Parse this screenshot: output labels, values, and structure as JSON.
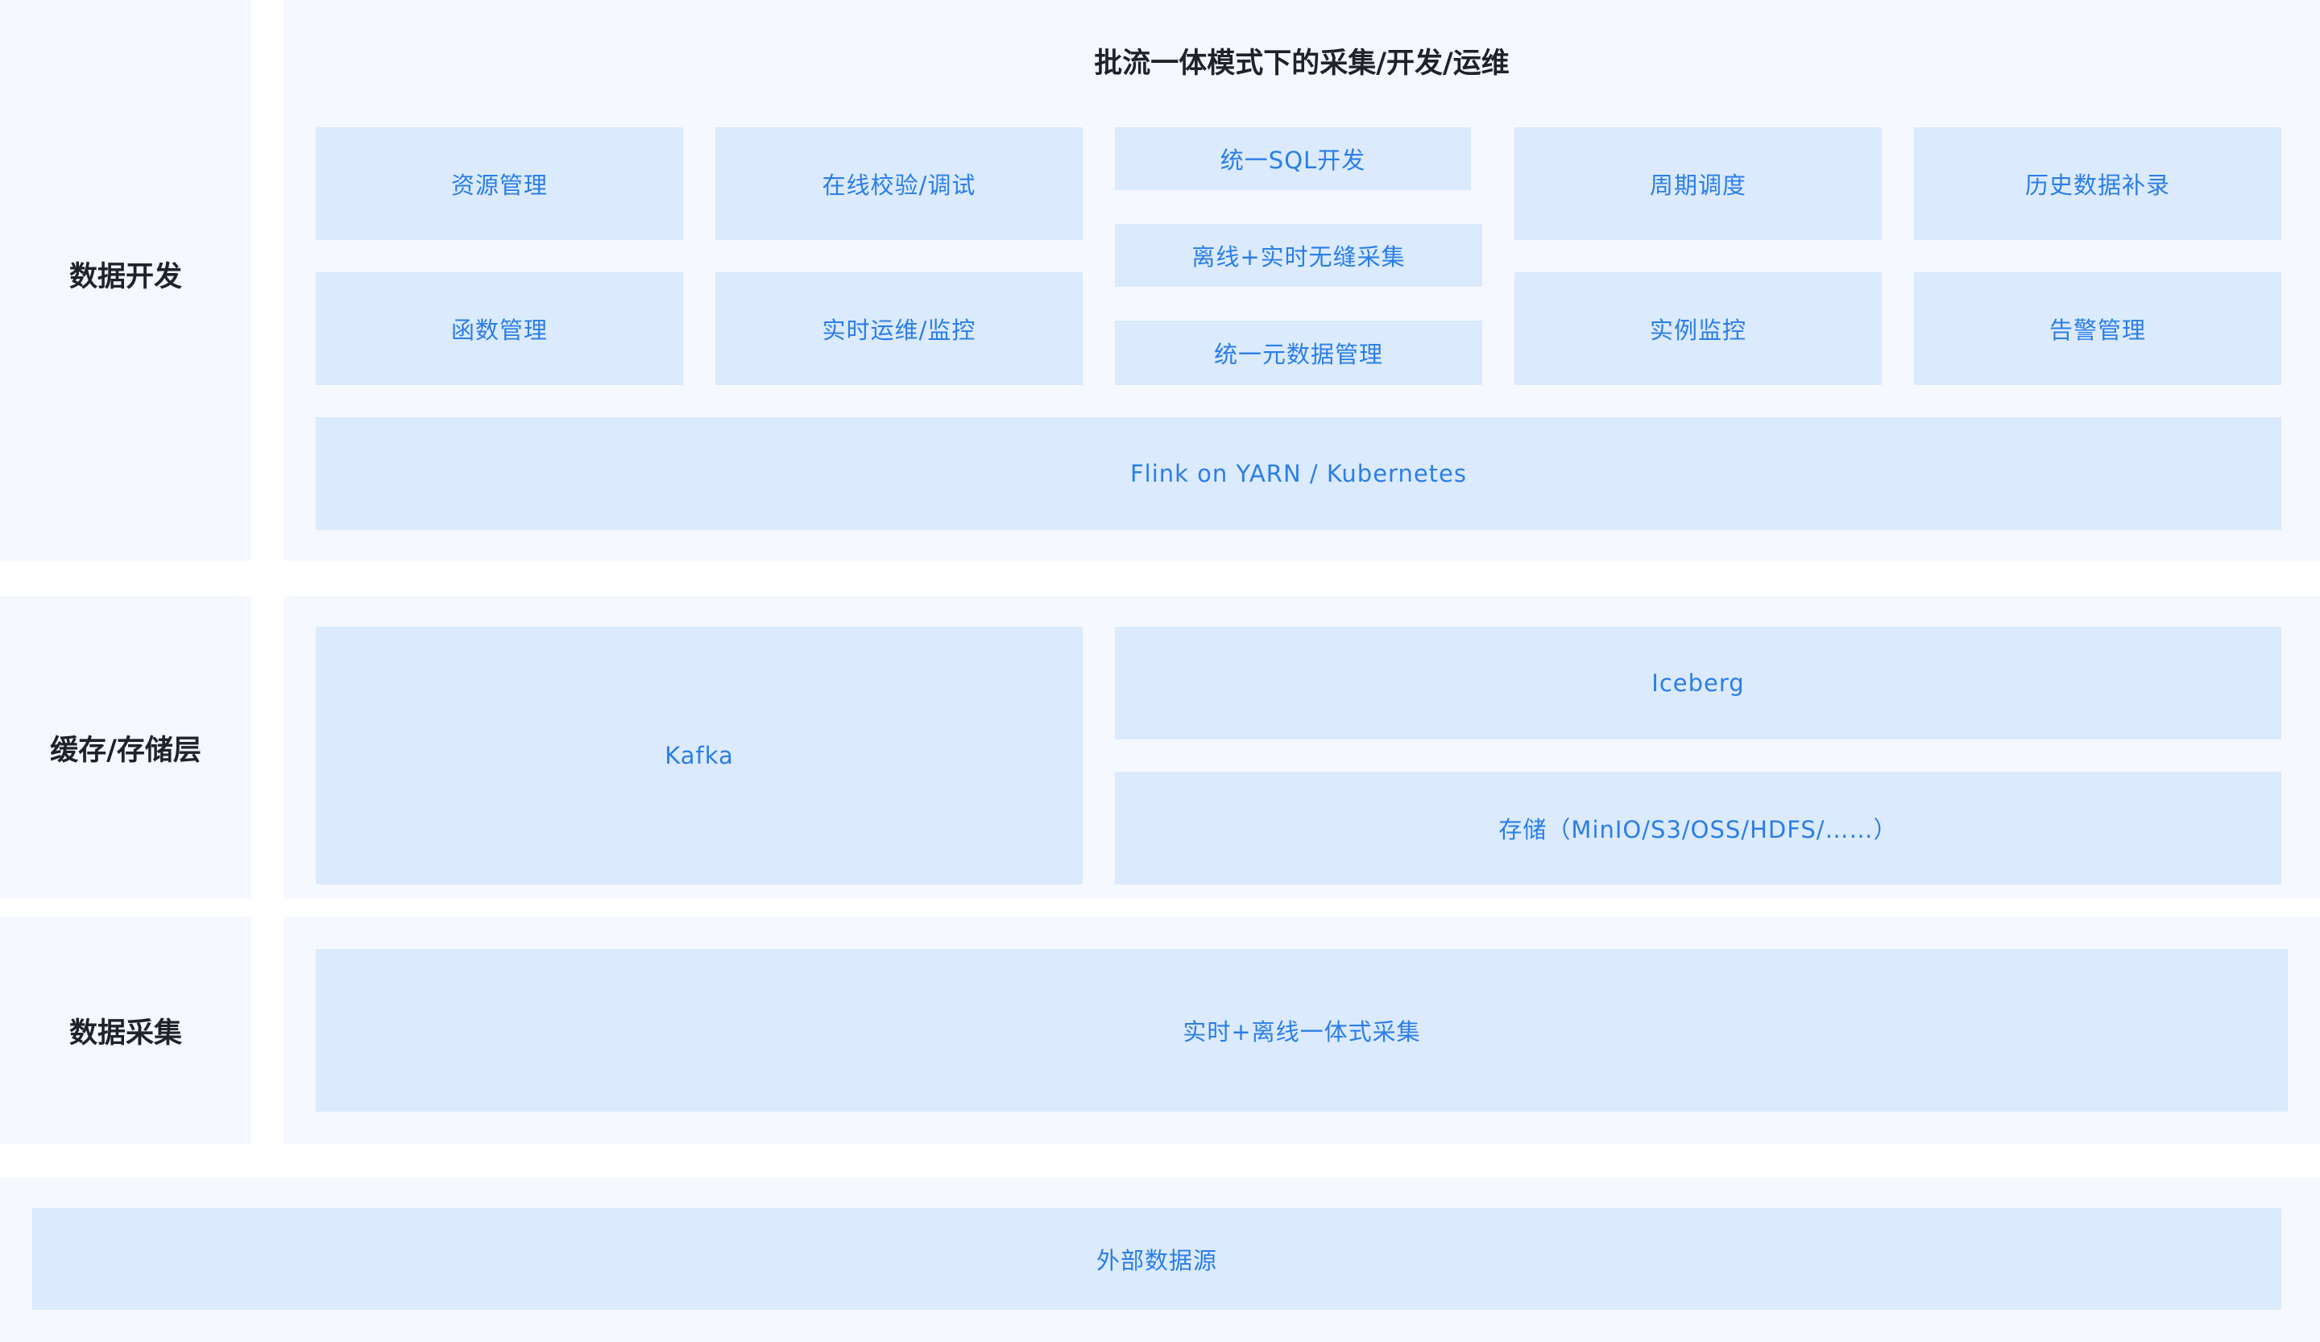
{
  "layers": {
    "dev": {
      "label": "数据开发",
      "title": "批流一体模式下的采集/开发/运维",
      "boxes": {
        "resource": "资源管理",
        "online_check": "在线校验/调试",
        "unified_sql": "统一SQL开发",
        "offline_realtime": "离线+实时无缝采集",
        "unified_meta": "统一元数据管理",
        "schedule": "周期调度",
        "history": "历史数据补录",
        "func": "函数管理",
        "realtime_ops": "实时运维/监控",
        "instance": "实例监控",
        "alert": "告警管理",
        "flink": "Flink on YARN / Kubernetes"
      }
    },
    "storage": {
      "label": "缓存/存储层",
      "boxes": {
        "kafka": "Kafka",
        "iceberg": "Iceberg",
        "store": "存储（MinIO/S3/OSS/HDFS/……）"
      }
    },
    "collect": {
      "label": "数据采集",
      "boxes": {
        "unified_collect": "实时+离线一体式采集"
      }
    },
    "source": {
      "boxes": {
        "external": "外部数据源"
      }
    }
  },
  "colors": {
    "panel_bg": "#f5f8fe",
    "box_bg": "#dbeafc",
    "box_text": "#2b7ee8",
    "label_text": "#1f2329"
  }
}
